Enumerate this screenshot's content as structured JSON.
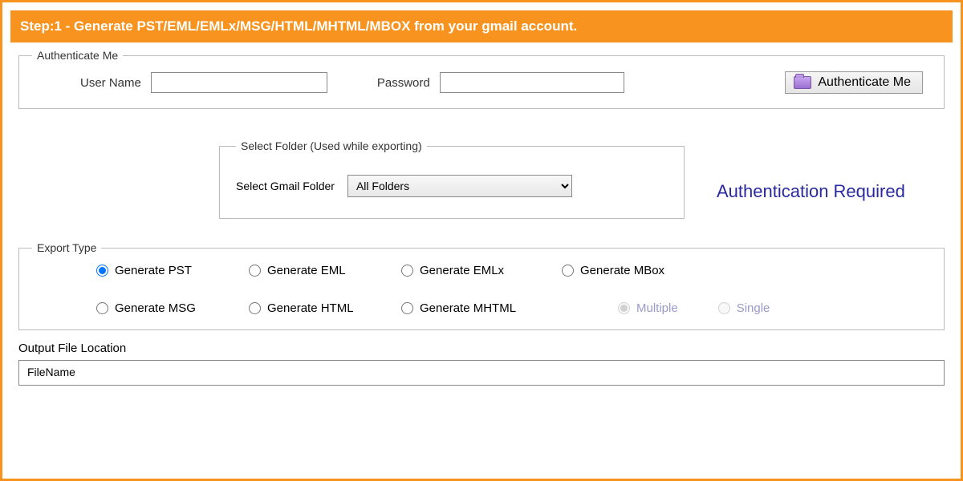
{
  "step_header": "Step:1 - Generate PST/EML/EMLx/MSG/HTML/MHTML/MBOX from your gmail account.",
  "auth": {
    "legend": "Authenticate Me",
    "username_label": "User Name",
    "username_value": "",
    "password_label": "Password",
    "password_value": "",
    "button_label": "Authenticate Me"
  },
  "folder": {
    "legend": "Select Folder (Used while exporting)",
    "label": "Select Gmail Folder",
    "selected": "All Folders"
  },
  "status_text": "Authentication Required",
  "export": {
    "legend": "Export Type",
    "options": {
      "pst": "Generate PST",
      "eml": "Generate EML",
      "emlx": "Generate EMLx",
      "mbox": "Generate MBox",
      "msg": "Generate MSG",
      "html": "Generate HTML",
      "mhtml": "Generate MHTML"
    },
    "selected": "pst",
    "mbox_sub": {
      "multiple": "Multiple",
      "single": "Single",
      "selected": "multiple"
    }
  },
  "output": {
    "label": "Output File Location",
    "filename_label": "FileName",
    "filename_value": ""
  }
}
